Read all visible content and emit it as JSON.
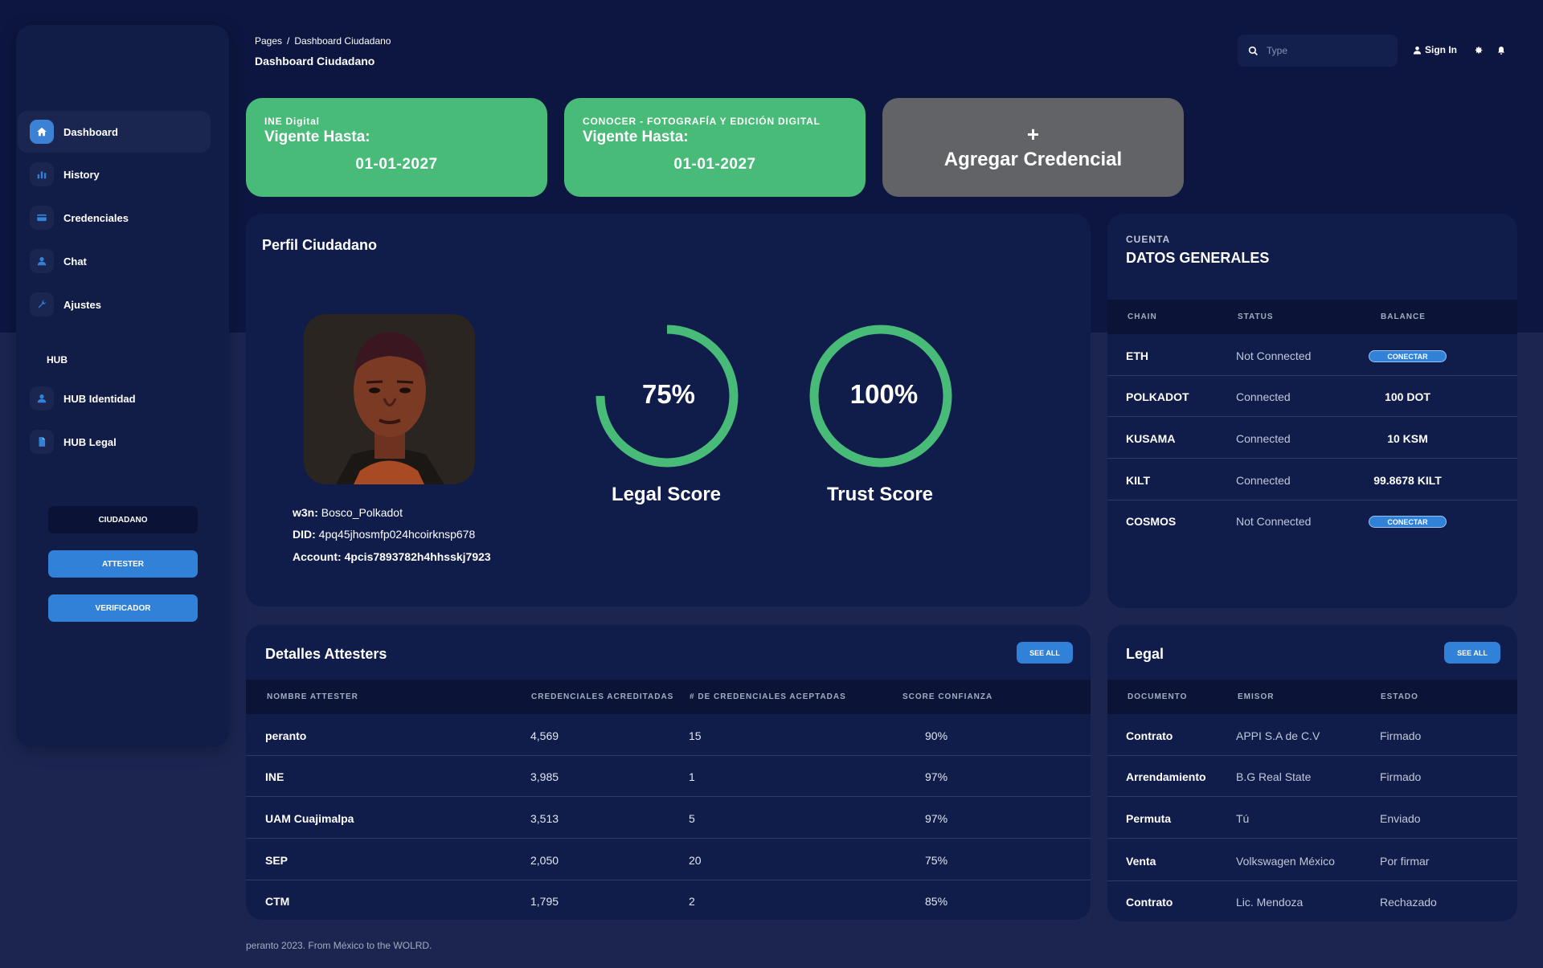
{
  "colors": {
    "accent": "#3181d8",
    "success": "#48bb78",
    "navy": "#0d1640",
    "card": "#101c4a"
  },
  "sidebar": {
    "items": [
      {
        "label": "Dashboard",
        "icon": "home-icon"
      },
      {
        "label": "History",
        "icon": "chart-icon"
      },
      {
        "label": "Credenciales",
        "icon": "credit-card-icon"
      },
      {
        "label": "Chat",
        "icon": "person-icon"
      },
      {
        "label": "Ajustes",
        "icon": "wrench-icon"
      }
    ],
    "hub_heading": "HUB",
    "hub_items": [
      {
        "label": "HUB Identidad",
        "icon": "person-icon"
      },
      {
        "label": "HUB Legal",
        "icon": "document-icon"
      }
    ],
    "roles": [
      "CIUDADANO",
      "ATTESTER",
      "VERIFICADOR"
    ]
  },
  "header": {
    "breadcrumb_root": "Pages",
    "breadcrumb_sep": "/",
    "breadcrumb_current": "Dashboard Ciudadano",
    "title": "Dashboard Ciudadano",
    "search_placeholder": "Type",
    "sign_in": "Sign In"
  },
  "credentials": [
    {
      "issuer": "INE Digital",
      "valid_label": "Vigente Hasta:",
      "date": "01-01-2027"
    },
    {
      "issuer": "CONOCER - FOTOGRAFÍA Y EDICIÓN DIGITAL",
      "valid_label": "Vigente Hasta:",
      "date": "01-01-2027"
    }
  ],
  "add_credential": {
    "plus": "+",
    "label": "Agregar Credencial"
  },
  "profile": {
    "title": "Perfil Ciudadano",
    "w3n_label": "w3n:",
    "w3n": "Bosco_Polkadot",
    "did_label": "DID:",
    "did": "4pq45jhosmfp024hcoirknsp678",
    "account_label": "Account:",
    "account": "4pcis7893782h4hhsskj7923",
    "legal_score": {
      "value": "75%",
      "fraction": 0.75,
      "label": "Legal Score"
    },
    "trust_score": {
      "value": "100%",
      "fraction": 1.0,
      "label": "Trust Score"
    }
  },
  "account": {
    "eyebrow": "CUENTA",
    "title": "DATOS GENERALES",
    "headers": [
      "CHAIN",
      "STATUS",
      "BALANCE"
    ],
    "rows": [
      {
        "chain": "ETH",
        "status": "Not Connected",
        "balance": "CONECTAR",
        "is_button": true
      },
      {
        "chain": "POLKADOT",
        "status": "Connected",
        "balance": "100 DOT",
        "is_button": false
      },
      {
        "chain": "KUSAMA",
        "status": "Connected",
        "balance": "10 KSM",
        "is_button": false
      },
      {
        "chain": "KILT",
        "status": "Connected",
        "balance": "99.8678 KILT",
        "is_button": false
      },
      {
        "chain": "COSMOS",
        "status": "Not Connected",
        "balance": "CONECTAR",
        "is_button": true
      }
    ]
  },
  "attesters": {
    "title": "Detalles Attesters",
    "see_all": "SEE ALL",
    "headers": [
      "NOMBRE ATTESTER",
      "CREDENCIALES ACREDITADAS",
      "# DE CREDENCIALES ACEPTADAS",
      "SCORE CONFIANZA"
    ],
    "rows": [
      [
        "peranto",
        "4,569",
        "15",
        "90%"
      ],
      [
        "INE",
        "3,985",
        "1",
        "97%"
      ],
      [
        "UAM Cuajimalpa",
        "3,513",
        "5",
        "97%"
      ],
      [
        "SEP",
        "2,050",
        "20",
        "75%"
      ],
      [
        "CTM",
        "1,795",
        "2",
        "85%"
      ]
    ]
  },
  "legal": {
    "title": "Legal",
    "see_all": "SEE ALL",
    "headers": [
      "DOCUMENTO",
      "EMISOR",
      "ESTADO"
    ],
    "rows": [
      [
        "Contrato",
        "APPI S.A de C.V",
        "Firmado"
      ],
      [
        "Arrendamiento",
        "B.G Real State",
        "Firmado"
      ],
      [
        "Permuta",
        "Tú",
        "Enviado"
      ],
      [
        "Venta",
        "Volkswagen México",
        "Por firmar"
      ],
      [
        "Contrato",
        "Lic. Mendoza",
        "Rechazado"
      ]
    ]
  },
  "footer": "peranto 2023. From México to the WOLRD."
}
